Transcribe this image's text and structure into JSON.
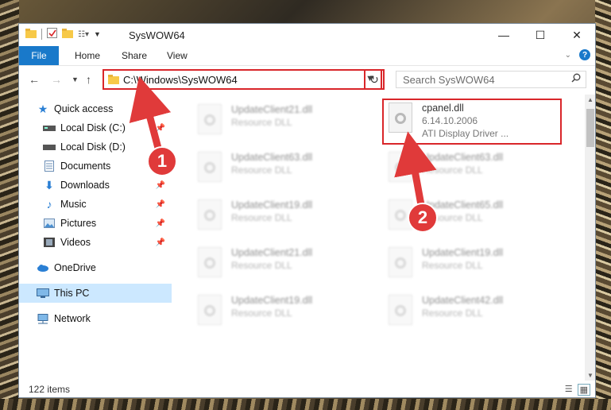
{
  "window": {
    "title": "SysWOW64"
  },
  "ribbon": {
    "file": "File",
    "home": "Home",
    "share": "Share",
    "view": "View"
  },
  "address": {
    "path": "C:\\Windows\\SysWOW64"
  },
  "search": {
    "placeholder": "Search SysWOW64"
  },
  "sidebar": {
    "quick_access": "Quick access",
    "items": [
      {
        "label": "Local Disk (C:)",
        "pinned": true
      },
      {
        "label": "Local Disk (D:)",
        "pinned": false
      },
      {
        "label": "Documents",
        "pinned": true
      },
      {
        "label": "Downloads",
        "pinned": true
      },
      {
        "label": "Music",
        "pinned": true
      },
      {
        "label": "Pictures",
        "pinned": true
      },
      {
        "label": "Videos",
        "pinned": true
      }
    ],
    "onedrive": "OneDrive",
    "thispc": "This PC",
    "network": "Network"
  },
  "files": [
    {
      "name": "UpdateClient21.dll",
      "type": "Resource DLL"
    },
    {
      "name": "cpanel.dll",
      "type": "6.14.10.2006",
      "extra": "ATI Display Driver ..."
    },
    {
      "name": "UpdateClient63.dll",
      "type": "Resource DLL"
    },
    {
      "name": "UpdateClient63.dll",
      "type": "Resource DLL"
    },
    {
      "name": "UpdateClient19.dll",
      "type": "Resource DLL"
    },
    {
      "name": "UpdateClient65.dll",
      "type": "Resource DLL"
    },
    {
      "name": "UpdateClient21.dll",
      "type": "Resource DLL"
    },
    {
      "name": "UpdateClient19.dll",
      "type": "Resource DLL"
    },
    {
      "name": "UpdateClient19.dll",
      "type": "Resource DLL"
    },
    {
      "name": "UpdateClient42.dll",
      "type": "Resource DLL"
    }
  ],
  "status": {
    "count": "122 items"
  },
  "callouts": {
    "one": "1",
    "two": "2"
  },
  "colors": {
    "accent": "#1979ca",
    "highlight": "#d9262a",
    "selected": "#cce8ff"
  }
}
